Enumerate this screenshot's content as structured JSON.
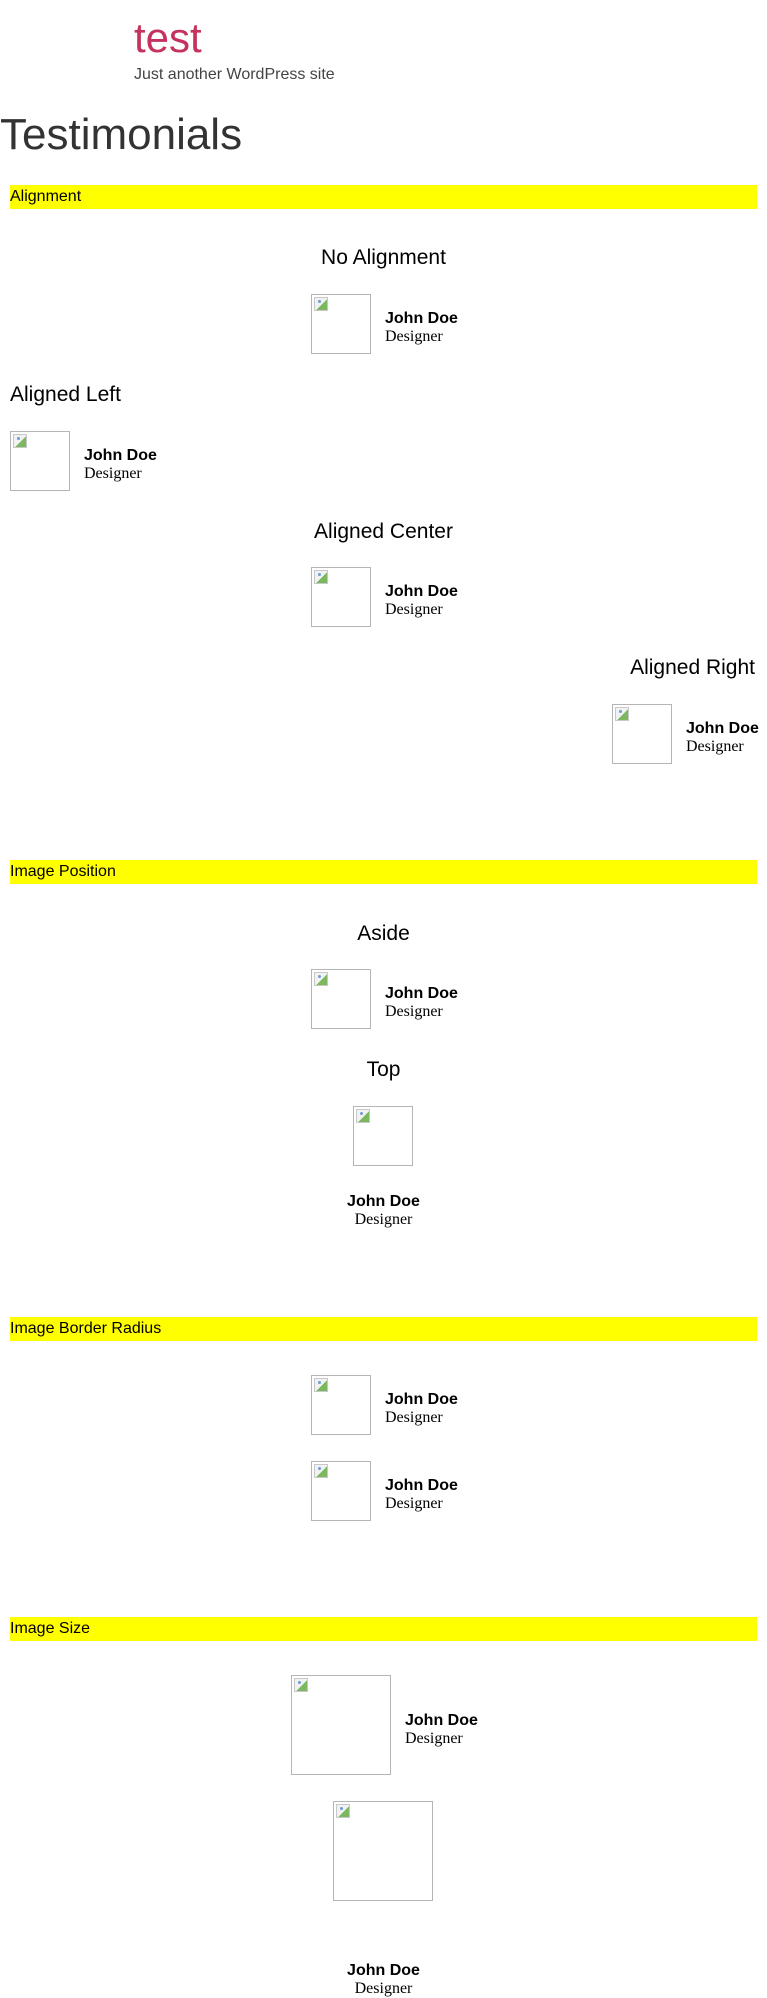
{
  "site": {
    "title": "test",
    "tagline": "Just another WordPress site"
  },
  "page": {
    "title": "Testimonials"
  },
  "sections": {
    "alignment": {
      "label": "Alignment",
      "headings": {
        "none": "No Alignment",
        "left": "Aligned Left",
        "center": "Aligned Center",
        "right": "Aligned Right"
      }
    },
    "image_position": {
      "label": "Image Position",
      "headings": {
        "aside": "Aside",
        "top": "Top"
      }
    },
    "image_border_radius": {
      "label": "Image Border Radius"
    },
    "image_size": {
      "label": "Image Size"
    }
  },
  "testimonial": {
    "name": "John Doe",
    "role": "Designer",
    "image_icon": "broken-image-icon"
  },
  "colors": {
    "site_title": "#c5325e",
    "section_bar": "#ffff00",
    "text": "#000000"
  }
}
